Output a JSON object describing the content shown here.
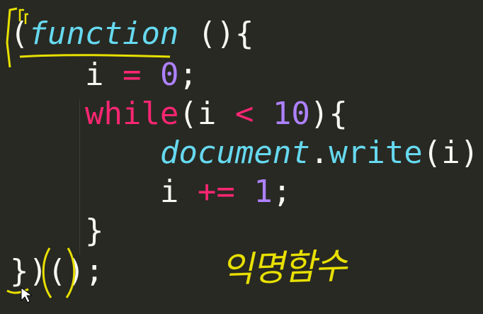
{
  "code": {
    "lines": [
      [
        [
          "(",
          "punc"
        ],
        [
          "function",
          "kw"
        ],
        [
          " ()",
          "punc"
        ],
        [
          "{",
          "punc"
        ]
      ],
      [
        [
          "    ",
          "id"
        ],
        [
          "i",
          "id"
        ],
        [
          " ",
          "id"
        ],
        [
          "=",
          "op"
        ],
        [
          " ",
          "id"
        ],
        [
          "0",
          "num"
        ],
        [
          ";",
          "punc"
        ]
      ],
      [
        [
          "    ",
          "id"
        ],
        [
          "while",
          "ctrl"
        ],
        [
          "(",
          "punc"
        ],
        [
          "i",
          "id"
        ],
        [
          " ",
          "id"
        ],
        [
          "<",
          "op"
        ],
        [
          " ",
          "id"
        ],
        [
          "10",
          "num"
        ],
        [
          "){",
          "punc"
        ]
      ],
      [
        [
          "        ",
          "id"
        ],
        [
          "document",
          "obj"
        ],
        [
          ".",
          "punc"
        ],
        [
          "write",
          "fn"
        ],
        [
          "(i);",
          "punc"
        ]
      ],
      [
        [
          "        ",
          "id"
        ],
        [
          "i",
          "id"
        ],
        [
          " ",
          "id"
        ],
        [
          "+=",
          "op"
        ],
        [
          " ",
          "id"
        ],
        [
          "1",
          "num"
        ],
        [
          ";",
          "punc"
        ]
      ],
      [
        [
          "    ",
          "id"
        ],
        [
          "}",
          "punc"
        ]
      ],
      [
        [
          "})",
          "punc"
        ],
        [
          "()",
          "punc"
        ],
        [
          ";",
          "punc"
        ]
      ]
    ]
  },
  "annotation": {
    "label": "익명함수"
  },
  "colors": {
    "background": "#282923",
    "keyword": "#66d9ef",
    "control": "#f92672",
    "number": "#ae81ff",
    "text": "#f8f8f2",
    "annotation": "#e8e000"
  }
}
